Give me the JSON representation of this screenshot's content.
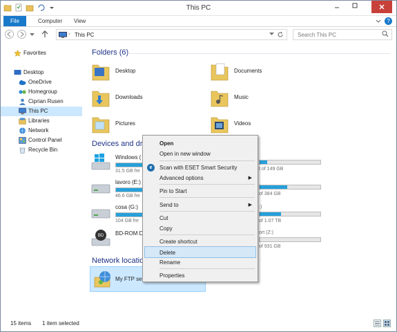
{
  "window": {
    "title": "This PC"
  },
  "ribbon": {
    "tabs": [
      {
        "label": "File"
      },
      {
        "label": "Computer"
      },
      {
        "label": "View"
      }
    ]
  },
  "address": {
    "path": "This PC",
    "separator": "›",
    "search_placeholder": "Search This PC"
  },
  "navpane": {
    "items": [
      {
        "label": "Favorites",
        "icon": "star-icon"
      },
      {
        "label": "Desktop",
        "icon": "desktop-icon"
      },
      {
        "label": "OneDrive",
        "icon": "cloud-icon"
      },
      {
        "label": "Homegroup",
        "icon": "homegroup-icon"
      },
      {
        "label": "Ciprian Rusen",
        "icon": "user-icon"
      },
      {
        "label": "This PC",
        "icon": "computer-icon",
        "selected": true
      },
      {
        "label": "Libraries",
        "icon": "libraries-icon"
      },
      {
        "label": "Network",
        "icon": "network-icon"
      },
      {
        "label": "Control Panel",
        "icon": "control-panel-icon"
      },
      {
        "label": "Recycle Bin",
        "icon": "recycle-bin-icon"
      }
    ]
  },
  "folders": {
    "header": "Folders (6)",
    "items": [
      {
        "label": "Desktop"
      },
      {
        "label": "Documents"
      },
      {
        "label": "Downloads"
      },
      {
        "label": "Music"
      },
      {
        "label": "Pictures"
      },
      {
        "label": "Videos"
      }
    ]
  },
  "devices": {
    "header": "Devices and driv",
    "items": [
      {
        "name": "Windows (",
        "free": "31.5 GB fre",
        "usage": 0.55
      },
      {
        "name": "lavoro (E:)",
        "free": "46.6 GB fre",
        "usage": 0.55
      },
      {
        "name": "cosa (G:)",
        "free": "104 GB fre",
        "usage": 0.55
      },
      {
        "name": "BD-ROM D",
        "free": "",
        "usage": null
      }
    ],
    "right_column": [
      {
        "free": "t of 149 GB",
        "usage": 0.12
      },
      {
        "free": "of 384 GB",
        "usage": 0.45
      },
      {
        "prefix": ":)",
        "free": "of 1.07 TB",
        "usage": 0.35
      },
      {
        "prefix": "ort (Z:)",
        "free": "of 931 GB",
        "usage": 0.0
      }
    ]
  },
  "network": {
    "header": "Network location",
    "items": [
      {
        "label": "My FTP ser"
      }
    ]
  },
  "status": {
    "count": "15 items",
    "selected": "1 item selected"
  },
  "context_menu": {
    "items": [
      {
        "label": "Open",
        "bold": true
      },
      {
        "label": "Open in new window"
      },
      {
        "label": "Scan with ESET Smart Security",
        "icon": "eset-icon"
      },
      {
        "label": "Advanced options",
        "submenu": true
      },
      {
        "label": "Pin to Start"
      },
      {
        "label": "Send to",
        "submenu": true
      },
      {
        "label": "Cut"
      },
      {
        "label": "Copy"
      },
      {
        "label": "Create shortcut"
      },
      {
        "label": "Delete",
        "hover": true
      },
      {
        "label": "Rename"
      },
      {
        "label": "Properties"
      }
    ],
    "submenu_arrow": "▶",
    "eset_glyph": "e"
  },
  "colors": {
    "accent": "#1979ca",
    "close": "#c7413a",
    "bar_fill": "#26a0da",
    "selection": "#cce8ff",
    "group_header": "#1e3287"
  }
}
